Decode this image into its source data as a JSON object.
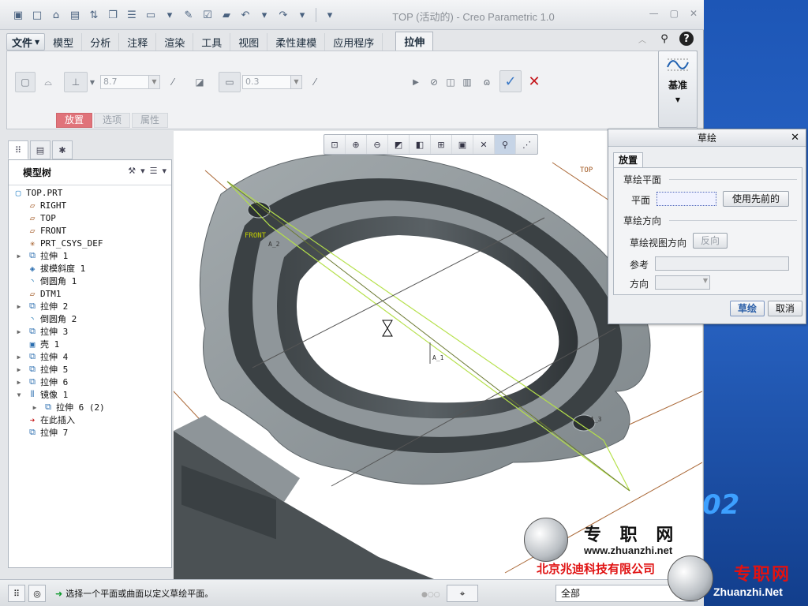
{
  "window": {
    "title": "TOP (活动的) - Creo Parametric 1.0"
  },
  "ribbon": {
    "tabs": [
      "文件",
      "模型",
      "分析",
      "注释",
      "渲染",
      "工具",
      "视图",
      "柔性建模",
      "应用程序",
      "拉伸"
    ],
    "depth_value": "8.7",
    "thickness_value": "0.3",
    "subtabs": [
      "放置",
      "选项",
      "属性"
    ],
    "datum_label": "基准"
  },
  "model_tree": {
    "title": "模型树",
    "items": [
      {
        "label": "TOP.PRT",
        "icon": "part-icon",
        "expandable": false,
        "indent": 0
      },
      {
        "label": "RIGHT",
        "icon": "datum-plane-icon",
        "expandable": false,
        "indent": 1
      },
      {
        "label": "TOP",
        "icon": "datum-plane-icon",
        "expandable": false,
        "indent": 1
      },
      {
        "label": "FRONT",
        "icon": "datum-plane-icon",
        "expandable": false,
        "indent": 1
      },
      {
        "label": "PRT_CSYS_DEF",
        "icon": "csys-icon",
        "expandable": false,
        "indent": 1
      },
      {
        "label": "拉伸 1",
        "icon": "extrude-icon",
        "expandable": true,
        "indent": 1
      },
      {
        "label": "拔模斜度 1",
        "icon": "draft-icon",
        "expandable": false,
        "indent": 1
      },
      {
        "label": "倒圆角 1",
        "icon": "round-icon",
        "expandable": false,
        "indent": 1
      },
      {
        "label": "DTM1",
        "icon": "datum-plane-icon",
        "expandable": false,
        "indent": 1
      },
      {
        "label": "拉伸 2",
        "icon": "extrude-icon",
        "expandable": true,
        "indent": 1
      },
      {
        "label": "倒圆角 2",
        "icon": "round-icon",
        "expandable": false,
        "indent": 1
      },
      {
        "label": "拉伸 3",
        "icon": "extrude-icon",
        "expandable": true,
        "indent": 1
      },
      {
        "label": "壳 1",
        "icon": "shell-icon",
        "expandable": false,
        "indent": 1
      },
      {
        "label": "拉伸 4",
        "icon": "extrude-icon",
        "expandable": true,
        "indent": 1
      },
      {
        "label": "拉伸 5",
        "icon": "extrude-icon",
        "expandable": true,
        "indent": 1
      },
      {
        "label": "拉伸 6",
        "icon": "extrude-icon",
        "expandable": true,
        "indent": 1
      },
      {
        "label": "镜像 1",
        "icon": "mirror-icon",
        "expandable": true,
        "expanded": true,
        "indent": 1
      },
      {
        "label": "拉伸 6 (2)",
        "icon": "extrude-icon",
        "expandable": true,
        "indent": 2
      },
      {
        "label": "在此插入",
        "icon": "insert-here-icon",
        "expandable": false,
        "indent": 1
      },
      {
        "label": "拉伸 7",
        "icon": "extrude-new-icon",
        "expandable": false,
        "indent": 1
      }
    ]
  },
  "graphics": {
    "labels": {
      "top_plane": "TOP",
      "front_plane": "FRONT",
      "axis1": "A_1",
      "axis2": "A_2",
      "axis3": "A_3"
    }
  },
  "sketch_dialog": {
    "title": "草绘",
    "tab": "放置",
    "section_plane": "草绘平面",
    "plane_label": "平面",
    "use_prev_button": "使用先前的",
    "section_direction": "草绘方向",
    "view_dir_label": "草绘视图方向",
    "flip_button": "反向",
    "ref_label": "参考",
    "orient_label": "方向",
    "sketch_button": "草绘",
    "cancel_button": "取消"
  },
  "statusbar": {
    "message": "选择一个平面或曲面以定义草绘平面。",
    "filter": "全部"
  },
  "watermark": {
    "brand": "专 职 网",
    "url": "www.zhuanzhi.net",
    "company": "北京兆迪科技有限公司",
    "red_brand": "专职网",
    "red_url": "Zhuanzhi.Net",
    "desktop_text": "02"
  },
  "colors": {
    "accent_blue": "#2d6fb0",
    "active_subtab": "#e0737a",
    "model_gray": "#8a9297",
    "datum_plane_edge": "#b5e04a",
    "datum_line": "#a0561f"
  }
}
